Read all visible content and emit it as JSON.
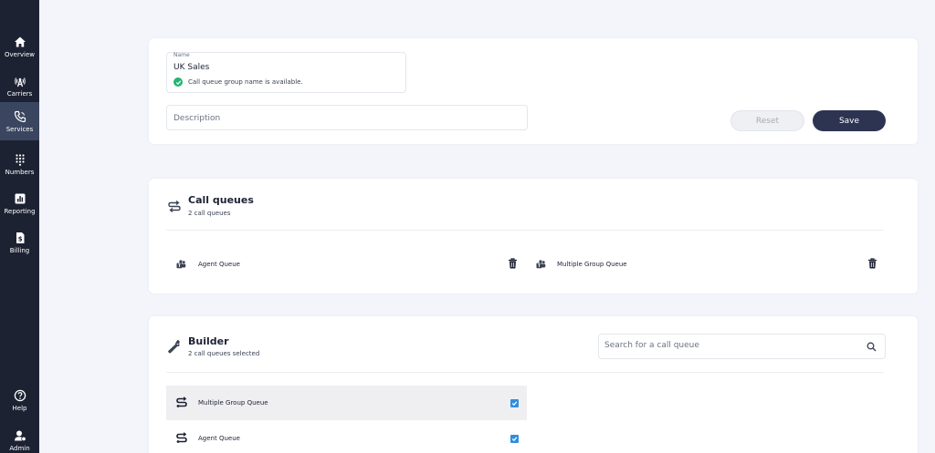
{
  "sidebar": {
    "items": [
      {
        "label": "Overview",
        "icon": "home-icon"
      },
      {
        "label": "Carriers",
        "icon": "antenna-icon"
      },
      {
        "label": "Services",
        "icon": "phone-icon",
        "active": true
      },
      {
        "label": "Numbers",
        "icon": "dialpad-icon"
      },
      {
        "label": "Reporting",
        "icon": "chart-icon"
      },
      {
        "label": "Billing",
        "icon": "invoice-icon"
      }
    ],
    "bottom": [
      {
        "label": "Help",
        "icon": "help-icon"
      },
      {
        "label": "Admin",
        "icon": "admin-icon"
      }
    ]
  },
  "details": {
    "name_label": "Name",
    "name_value": "UK Sales",
    "availability": "Call queue group name is available.",
    "description_placeholder": "Description",
    "reset_label": "Reset",
    "save_label": "Save"
  },
  "call_queues": {
    "title": "Call queues",
    "subtitle": "2 call queues",
    "items": [
      {
        "name": "Agent Queue"
      },
      {
        "name": "Multiple Group Queue"
      }
    ]
  },
  "builder": {
    "title": "Builder",
    "subtitle": "2 call queues selected",
    "search_placeholder": "Search for a call queue",
    "rows": [
      {
        "name": "Multiple Group Queue",
        "checked": true
      },
      {
        "name": "Agent Queue",
        "checked": true
      }
    ]
  },
  "colors": {
    "sidebar": "#1d2233",
    "sidebar_active": "#3a4560",
    "primary": "#2d3452",
    "success": "#22b573",
    "checkbox": "#2f8ee0"
  }
}
